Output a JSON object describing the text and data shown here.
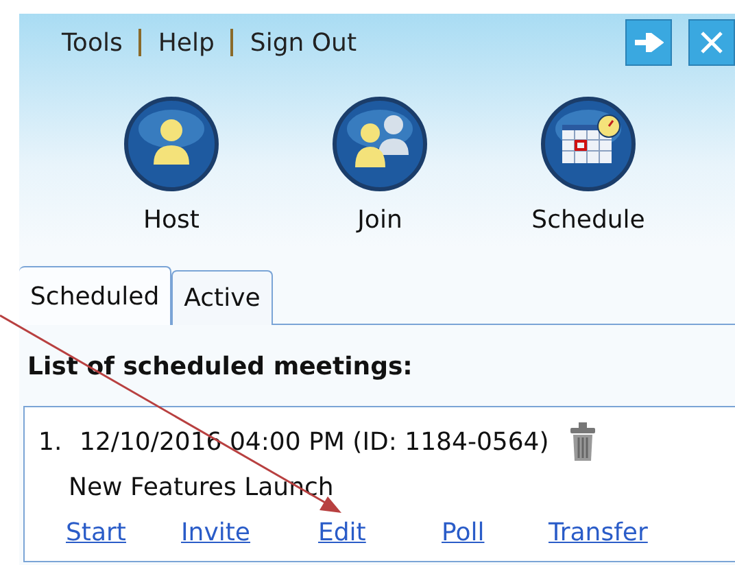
{
  "menu": [
    "Tools",
    "Help",
    "Sign Out"
  ],
  "window_buttons": [
    {
      "kind": "arrow"
    },
    {
      "kind": "close"
    }
  ],
  "actions": [
    {
      "kind": "host",
      "label": "Host"
    },
    {
      "kind": "join",
      "label": "Join"
    },
    {
      "kind": "schedule",
      "label": "Schedule"
    }
  ],
  "tabs": [
    {
      "label": "Scheduled",
      "selected": true
    },
    {
      "label": "Active",
      "selected": false
    }
  ],
  "heading": "List of scheduled meetings:",
  "meetings": [
    {
      "number": "1.",
      "when": "12/10/2016 04:00 PM (ID: 1184-0564)",
      "title": "New Features Launch",
      "links": [
        "Start",
        "Invite",
        "Edit",
        "Poll",
        "Transfer"
      ]
    }
  ],
  "annotation": {
    "kind": "arrow"
  }
}
